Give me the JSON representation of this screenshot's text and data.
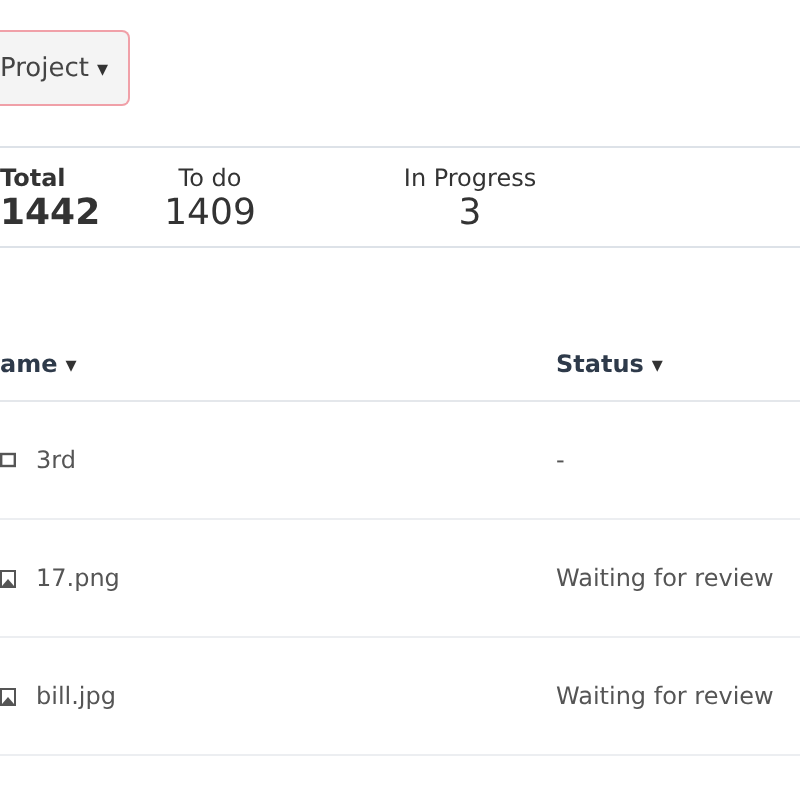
{
  "filter_button": {
    "label": "Project",
    "caret": "▾"
  },
  "stats": [
    {
      "label": "Total",
      "value": "1442",
      "emphasized": true
    },
    {
      "label": "To do",
      "value": "1409",
      "emphasized": false
    },
    {
      "label": "In Progress",
      "value": "3",
      "emphasized": false
    }
  ],
  "table": {
    "columns": [
      {
        "label": "ame",
        "caret": "▾"
      },
      {
        "label": "Status",
        "caret": "▾"
      }
    ],
    "rows": [
      {
        "kind": "folder",
        "name": "3rd",
        "status": "-"
      },
      {
        "kind": "image",
        "name": "17.png",
        "status": "Waiting for review"
      },
      {
        "kind": "image",
        "name": "bill.jpg",
        "status": "Waiting for review"
      }
    ]
  }
}
